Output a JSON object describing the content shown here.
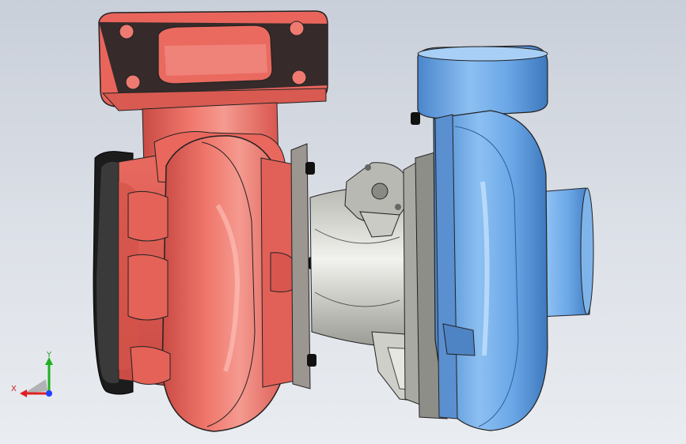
{
  "viewport": {
    "model": "turbocharger-assembly"
  },
  "triad": {
    "x_label": "X",
    "y_label": "Y"
  },
  "colors": {
    "turbine_housing": "#ec6e64",
    "compressor_housing": "#6aa6e6",
    "center_housing": "#cfcfc9",
    "gasket": "#202020",
    "background": "#d6dae2",
    "axis_x": "#e02020",
    "axis_y": "#20b020",
    "axis_z": "#2040ff"
  }
}
